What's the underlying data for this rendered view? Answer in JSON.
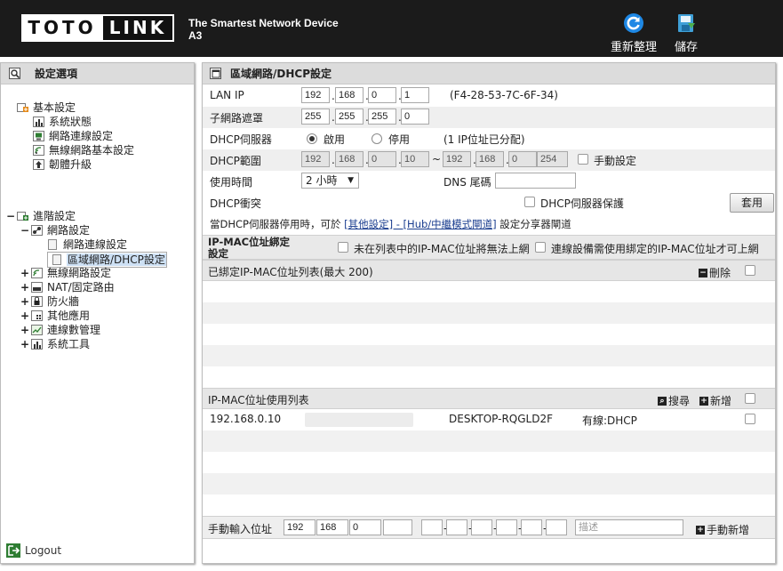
{
  "header": {
    "logo_left": "TOTO",
    "logo_right": "LINK",
    "slogan": "The Smartest Network Device",
    "model": "A3",
    "refresh_label": "重新整理",
    "save_label": "儲存"
  },
  "sidebar": {
    "title": "設定選項",
    "basic": {
      "label": "基本設定",
      "items": [
        "系統狀態",
        "網路連線設定",
        "無線網路基本設定",
        "韌體升級"
      ]
    },
    "advanced": {
      "label": "進階設定",
      "network": {
        "label": "網路設定",
        "items": [
          "網路連線設定",
          "區域網路/DHCP設定"
        ]
      },
      "items": [
        "無線網路設定",
        "NAT/固定路由",
        "防火牆",
        "其他應用",
        "連線數管理",
        "系統工具"
      ]
    },
    "logout": "Logout"
  },
  "main": {
    "title": "區域網路/DHCP設定",
    "lan_ip": {
      "label": "LAN IP",
      "octets": [
        "192",
        "168",
        "0",
        "1"
      ],
      "mac": "(F4-28-53-7C-6F-34)"
    },
    "subnet": {
      "label": "子網路遮罩",
      "octets": [
        "255",
        "255",
        "255",
        "0"
      ]
    },
    "dhcp_server": {
      "label": "DHCP伺服器",
      "enable": "啟用",
      "disable": "停用",
      "status": "(1 IP位址已分配)"
    },
    "dhcp_range": {
      "label": "DHCP範圍",
      "start": [
        "192",
        "168",
        "0",
        "10"
      ],
      "sep": "~",
      "end": [
        "192",
        "168",
        "0",
        "254"
      ],
      "manual": "手動設定"
    },
    "lease": {
      "label": "使用時間",
      "value": "2 小時",
      "dns_label": "DNS 尾碼",
      "dns_value": ""
    },
    "conflict": {
      "label": "DHCP衝突",
      "protect": "DHCP伺服器保護",
      "apply": "套用"
    },
    "note": {
      "prefix": "當DHCP伺服器停用時，可於 ",
      "link": "[其他設定] - [Hub/中繼模式閘道]",
      "suffix": " 設定分享器閘道"
    },
    "binding": {
      "title": "IP-MAC位址綁定設定",
      "opt1": "未在列表中的IP-MAC位址將無法上網",
      "opt2": "連線設備需使用綁定的IP-MAC位址才可上網"
    },
    "bound_list": {
      "title": "已綁定IP-MAC位址列表(最大 200)",
      "delete": "刪除"
    },
    "usage_list": {
      "title": "IP-MAC位址使用列表",
      "search": "搜尋",
      "add": "新增",
      "rows": [
        {
          "ip": "192.168.0.10",
          "name": "DESKTOP-RQGLD2F",
          "type": "有線:DHCP"
        }
      ]
    },
    "manual_entry": {
      "label": "手動輸入位址",
      "octets": [
        "192",
        "168",
        "0",
        ""
      ],
      "desc_placeholder": "描述",
      "add": "手動新增"
    }
  }
}
